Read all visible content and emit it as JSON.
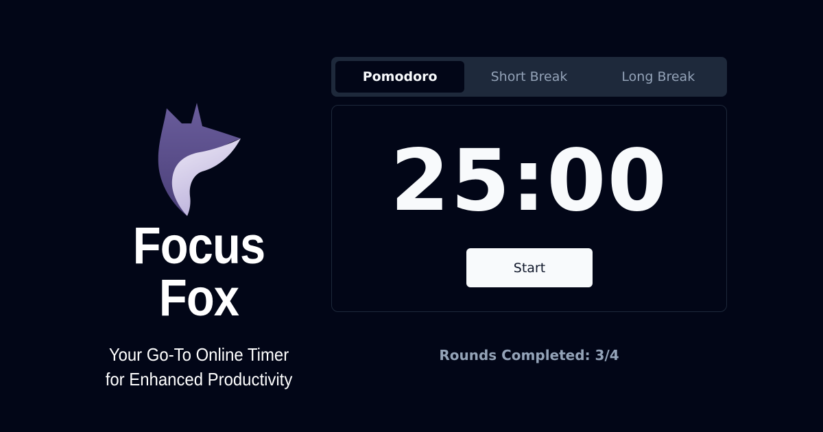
{
  "brand": {
    "name": "Focus Fox",
    "tagline_line1": "Your Go-To Online Timer",
    "tagline_line2": "for Enhanced Productivity",
    "logo_icon": "fox-head-icon",
    "logo_colors": [
      "#5b4f8e",
      "#d9d3ec"
    ]
  },
  "tabs": [
    {
      "label": "Pomodoro",
      "active": true
    },
    {
      "label": "Short Break",
      "active": false
    },
    {
      "label": "Long Break",
      "active": false
    }
  ],
  "timer": {
    "display": "25:00",
    "start_label": "Start"
  },
  "rounds": {
    "text": "Rounds Completed: 3/4"
  },
  "colors": {
    "background": "#020617",
    "tab_bar": "#1e293b",
    "text_primary": "#f8fafc",
    "text_muted": "#94a3b8"
  }
}
